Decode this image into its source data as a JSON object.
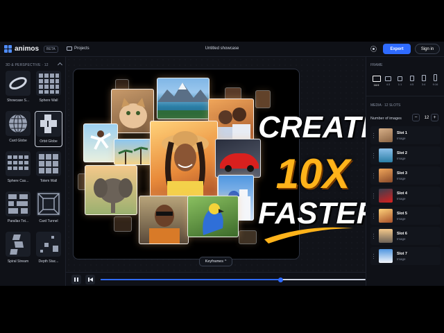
{
  "app": {
    "name": "animos",
    "badge": "BETA"
  },
  "topbar": {
    "projects": "Projects",
    "title": "Untitled showcase",
    "export": "Export",
    "signin": "Sign in"
  },
  "left": {
    "section": "3D & PERSPECTIVE · 12",
    "presets": [
      {
        "label": "Showcase S..."
      },
      {
        "label": "Sphere Wall"
      },
      {
        "label": "Card Globe"
      },
      {
        "label": "Orbit Globe"
      },
      {
        "label": "Sphere Cas..."
      },
      {
        "label": "Totem Wall"
      },
      {
        "label": "Parallax Tot..."
      },
      {
        "label": "Card Tunnel"
      },
      {
        "label": "Spiral Stream"
      },
      {
        "label": "Depth Stac..."
      }
    ],
    "selected": "Orbit Globe"
  },
  "headline": {
    "line1": "CREATE",
    "line2": "10X",
    "line3": "FASTER"
  },
  "canvas": {
    "keyframes": "Keyframes"
  },
  "timeline": {
    "progress": 0.68
  },
  "right": {
    "frame_head": "FRAME",
    "ratios": [
      "16:9",
      "4:3",
      "1:1",
      "4:5",
      "3:4",
      "9:16"
    ],
    "selected_ratio": "16:9",
    "media_head": "MEDIA · 12 SLOTS",
    "num_label": "Number of images",
    "num_value": "12",
    "minus": "−",
    "plus": "+",
    "slots": [
      {
        "name": "Slot 1",
        "type": "Image"
      },
      {
        "name": "Slot 2",
        "type": "Image"
      },
      {
        "name": "Slot 3",
        "type": "Image"
      },
      {
        "name": "Slot 4",
        "type": "Image"
      },
      {
        "name": "Slot 5",
        "type": "Image"
      },
      {
        "name": "Slot 6",
        "type": "Image"
      },
      {
        "name": "Slot 7",
        "type": "Image"
      }
    ]
  },
  "colors": {
    "accent": "#2f6bff",
    "headline_orange": "#ffb31a"
  }
}
